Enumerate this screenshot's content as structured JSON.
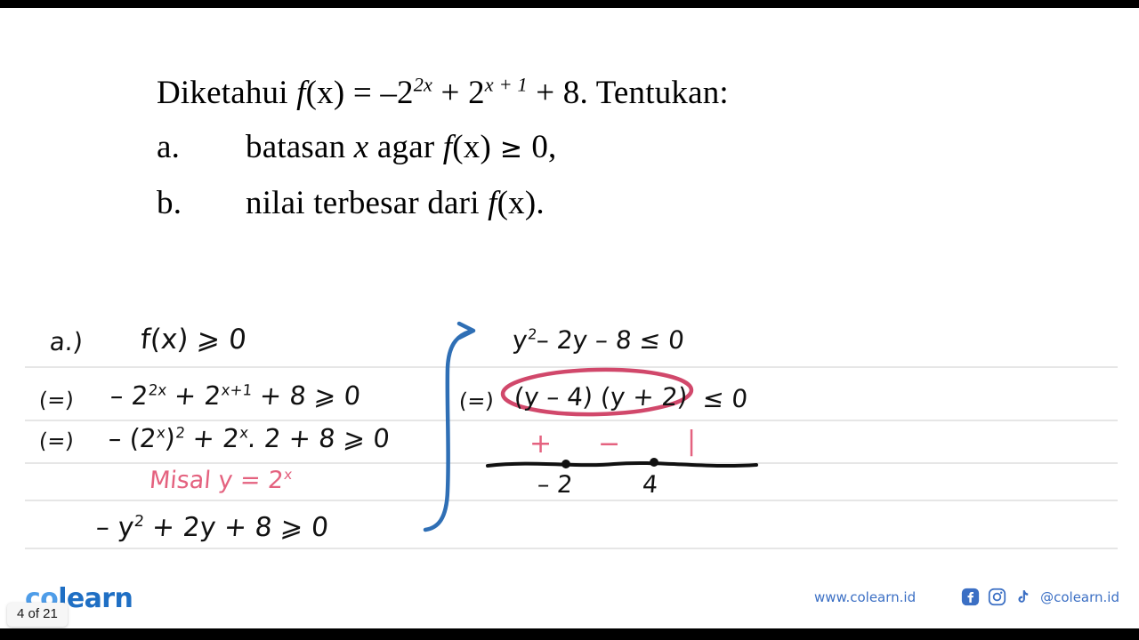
{
  "problem": {
    "line1": {
      "pre": "Diketahui ",
      "fx": "f",
      "fx_args": "(x)",
      "eq": " = ",
      "term1_base": "–2",
      "term1_exp": "2x",
      "plus1": " + ",
      "term2_base": "2",
      "term2_exp": "x + 1",
      "tail": " + 8. Tentukan:"
    },
    "line_a": {
      "label": "a.",
      "text_pre": "batasan ",
      "var": "x",
      "text_mid": " agar ",
      "fn": "f",
      "fn_args": "(x)",
      "rel": " ≥ ",
      "value": "0,"
    },
    "line_b": {
      "label": "b.",
      "text": "nilai terbesar dari ",
      "fn": "f",
      "fn_args": "(x)",
      "tail": "."
    }
  },
  "work_left": {
    "line1_label": "a.)",
    "line1_expr": "f(x) ⩾ 0",
    "line2_arrow": "(=)",
    "line2_a": "– 2",
    "line2_a_exp": "2x",
    "line2_b": " + 2",
    "line2_b_exp": "x+1",
    "line2_c": " + 8 ⩾ 0",
    "line3_arrow": "(=)",
    "line3_a": "– (2",
    "line3_a_exp": "x",
    "line3_b": ")",
    "line3_b_exp": "2",
    "line3_c": " + 2",
    "line3_c_exp": "x",
    "line3_d": ". 2 + 8 ⩾ 0",
    "line4_note": "Misal y = 2",
    "line4_note_exp": "x",
    "line5": "– y",
    "line5_exp": "2",
    "line5_tail": " + 2y + 8 ⩾ 0"
  },
  "work_right": {
    "line1_a": "y",
    "line1_a_exp": "2",
    "line1_b": "– 2y – 8 ≤ 0",
    "line2_arrow": "(=)",
    "line2_factored": "(y – 4) (y + 2)",
    "line2_rel": " ≤ 0"
  },
  "numberline": {
    "signs": [
      "+",
      "−",
      "|"
    ],
    "ticks": [
      "– 2",
      "4"
    ]
  },
  "footer": {
    "logo_co": "co",
    "logo_learn": "learn",
    "page_indicator": "4 of 21",
    "website": "www.colearn.id",
    "handle": "@colearn.id",
    "social": [
      "facebook-icon",
      "instagram-icon",
      "tiktok-icon"
    ]
  },
  "colors": {
    "pink_ink": "#e4627f",
    "crimson_ellipse": "#d1486b",
    "blue_arrow": "#2f6fb5",
    "rule_line": "#e6e6e6",
    "logo_co": "#4f9de8",
    "logo_learn": "#1f6fc4",
    "footer_text": "#3b6fc4"
  }
}
